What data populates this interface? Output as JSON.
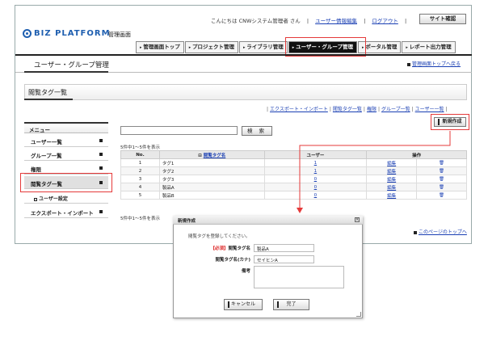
{
  "header": {
    "logo_text": "BIZ PLATFORM",
    "logo_sub": "管理画面",
    "greeting": "こんにちは CNWシステム管理者 さん",
    "user_info_link": "ユーザー情報編集",
    "logout_link": "ログアウト",
    "site_button": "サイト確認"
  },
  "nav": {
    "tabs": [
      {
        "label": "管理画面トップ"
      },
      {
        "label": "プロジェクト管理"
      },
      {
        "label": "ライブラリ管理"
      },
      {
        "label": "ユーザー・グループ管理"
      },
      {
        "label": "ポータル管理"
      },
      {
        "label": "レポート出力管理"
      }
    ]
  },
  "page": {
    "title": "ユーザー・グループ管理",
    "back_link": "管理画面トップへ戻る"
  },
  "section": {
    "title": "閲覧タグ一覧",
    "sublinks": [
      "エクスポート・インポート",
      "閲覧タグ一覧",
      "権限",
      "グループ一覧",
      "ユーザー一覧"
    ],
    "new_button": "新規作成"
  },
  "sidebar": {
    "heading": "メニュー",
    "items": [
      {
        "label": "ユーザー一覧"
      },
      {
        "label": "グループ一覧"
      },
      {
        "label": "権限"
      },
      {
        "label": "閲覧タグ一覧"
      },
      {
        "label": "ユーザー設定"
      },
      {
        "label": "エクスポート・インポート"
      }
    ]
  },
  "search": {
    "button": "検 索",
    "count_top": "5件中1～5件を表示",
    "count_bottom": "5件中1～5件を表示"
  },
  "table": {
    "headers": [
      "No.",
      "閲覧タグ名",
      "ユーザー",
      "操作"
    ],
    "sort_marker": "⊟",
    "rows": [
      {
        "no": "1",
        "name": "タグ1",
        "users": "1",
        "edit": "編集",
        "del": "🗑"
      },
      {
        "no": "2",
        "name": "タグ2",
        "users": "1",
        "edit": "編集",
        "del": "🗑"
      },
      {
        "no": "3",
        "name": "タグ3",
        "users": "0",
        "edit": "編集",
        "del": "🗑"
      },
      {
        "no": "4",
        "name": "製品A",
        "users": "0",
        "edit": "編集",
        "del": "🗑"
      },
      {
        "no": "5",
        "name": "製品B",
        "users": "0",
        "edit": "編集",
        "del": "🗑"
      }
    ]
  },
  "dialog": {
    "title": "新規作成",
    "close": "×",
    "instruction": "閲覧タグを登録してください。",
    "required_mark": "【必須】",
    "field_name_label": "閲覧タグ名",
    "field_name_value": "製品A",
    "field_kana_label": "閲覧タグ名(カナ)",
    "field_kana_value": "セイヒンA",
    "field_note_label": "備考",
    "field_note_value": "",
    "cancel_button": "キャンセル",
    "done_button": "完了"
  },
  "footer": {
    "page_top": "このページのトップへ"
  },
  "colors": {
    "highlight": "#e53a3a",
    "brand": "#1f5fb0",
    "link": "#1a3fb3"
  }
}
